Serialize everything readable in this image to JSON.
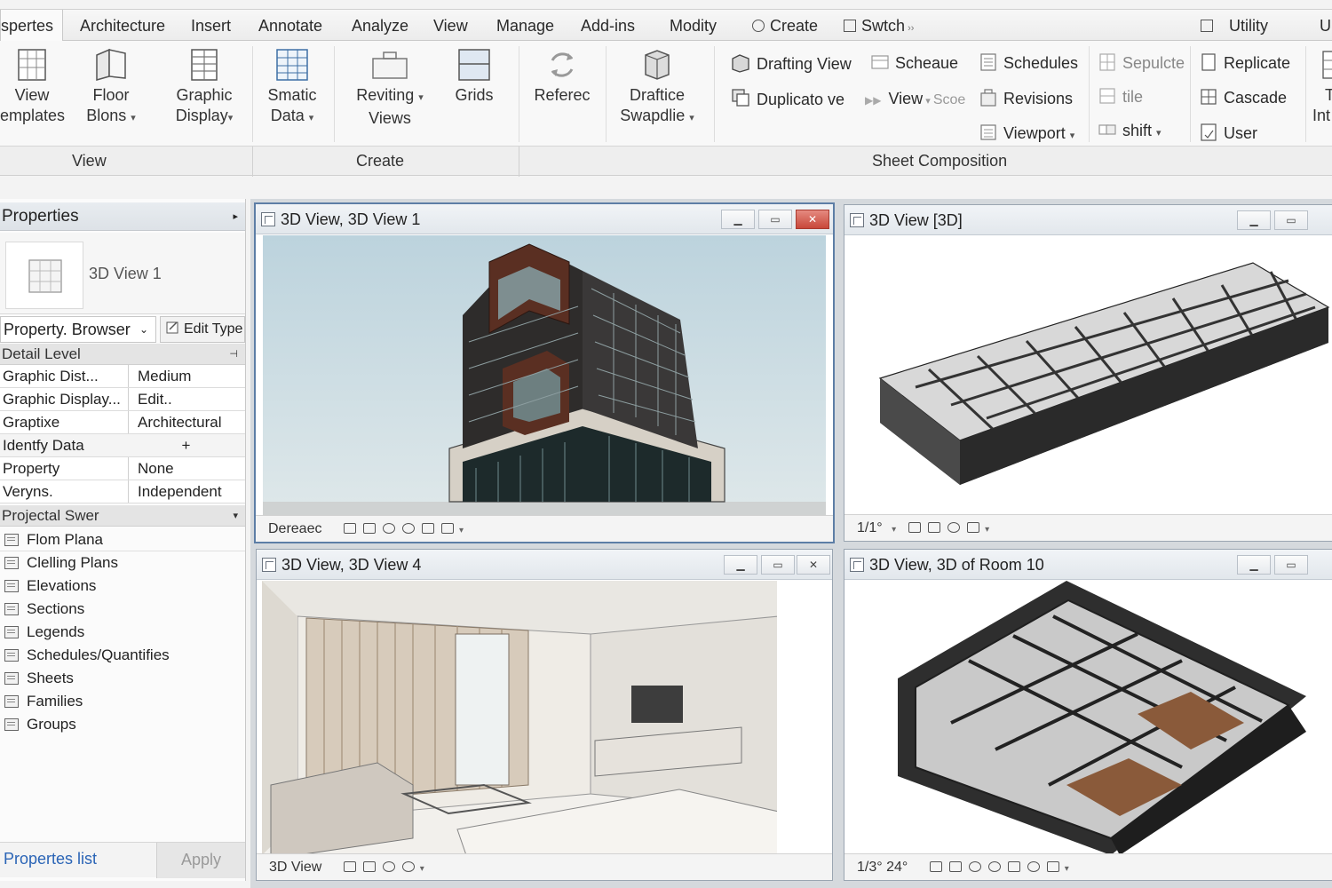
{
  "ribbon_tabs": [
    {
      "label": "spertes"
    },
    {
      "label": "Architecture"
    },
    {
      "label": "Insert"
    },
    {
      "label": "Annotate"
    },
    {
      "label": "Analyze"
    },
    {
      "label": "View"
    },
    {
      "label": "Manage"
    },
    {
      "label": "Add-ins"
    },
    {
      "label": "Modity"
    },
    {
      "label": "Create"
    },
    {
      "label": "Swtch"
    },
    {
      "label": "Utility"
    },
    {
      "label": "Ui"
    }
  ],
  "ribbon": {
    "view_templates": {
      "line1": "View",
      "line2": "emplates"
    },
    "floor_plans": {
      "line1": "Floor",
      "line2": "Blons"
    },
    "graphic_display": {
      "line1": "Graphic",
      "line2": "Display"
    },
    "smatic_data": {
      "line1": "Smatic",
      "line2": "Data"
    },
    "reviting_views": {
      "line1": "Reviting",
      "line2": "Views"
    },
    "grids": {
      "line1": "Grids"
    },
    "referec": {
      "line1": "Referec"
    },
    "draftice_swapdlie": {
      "line1": "Draftice",
      "line2": "Swapdlie"
    },
    "drafting_view": "Drafting View",
    "duplicato_ve": "Duplicato ve",
    "scheaue": "Scheaue",
    "view_scoe": "View",
    "scoe": "Scoe",
    "schedules": "Schedules",
    "revisions": "Revisions",
    "viewport": "Viewport",
    "sepulcte": "Sepulcte",
    "tile": "tile",
    "shift": "shift",
    "replicate": "Replicate",
    "cascade": "Cascade",
    "user": "User",
    "cut_t": "T",
    "cut_int": "Int"
  },
  "panels": {
    "view": "View",
    "create": "Create",
    "sheet_composition": "Sheet Composition"
  },
  "properties": {
    "header": "Properties",
    "type_name": "3D View 1",
    "selector": "Property. Browser",
    "edit_type": "Edit Type",
    "group1": "Detail Level",
    "rows": [
      {
        "key": "Graphic Dist...",
        "value": "Medium"
      },
      {
        "key": "Graphic Display...",
        "value": "Edit.."
      },
      {
        "key": "Graptixe",
        "value": "Architectural"
      },
      {
        "key": "Identfy Data",
        "value": "+"
      },
      {
        "key": "Property",
        "value": "None"
      },
      {
        "key": "Veryns.",
        "value": "Independent"
      }
    ],
    "group2": "Projectal Swer",
    "browser_items": [
      {
        "label": "Flom Plana"
      },
      {
        "label": "Clelling Plans"
      },
      {
        "label": "Elevations"
      },
      {
        "label": "Sections"
      },
      {
        "label": "Legends"
      },
      {
        "label": "Schedules/Quantifies"
      },
      {
        "label": "Sheets"
      },
      {
        "label": "Families"
      },
      {
        "label": "Groups"
      }
    ],
    "footer_link": "Propertes list",
    "apply": "Apply"
  },
  "views": {
    "v1": {
      "title": "3D View, 3D View 1",
      "footer": "Dereaec"
    },
    "v2": {
      "title": "3D View [3D]",
      "footer": "1/1°"
    },
    "v3": {
      "title": "3D View,  3D View 4",
      "footer": "3D View"
    },
    "v4": {
      "title": "3D View, 3D of Room 10",
      "footer": "1/3° 24°"
    }
  },
  "colors": {
    "accent_link": "#2a64b6",
    "active_border": "#5d7ea6",
    "close_button": "#c8473a"
  }
}
